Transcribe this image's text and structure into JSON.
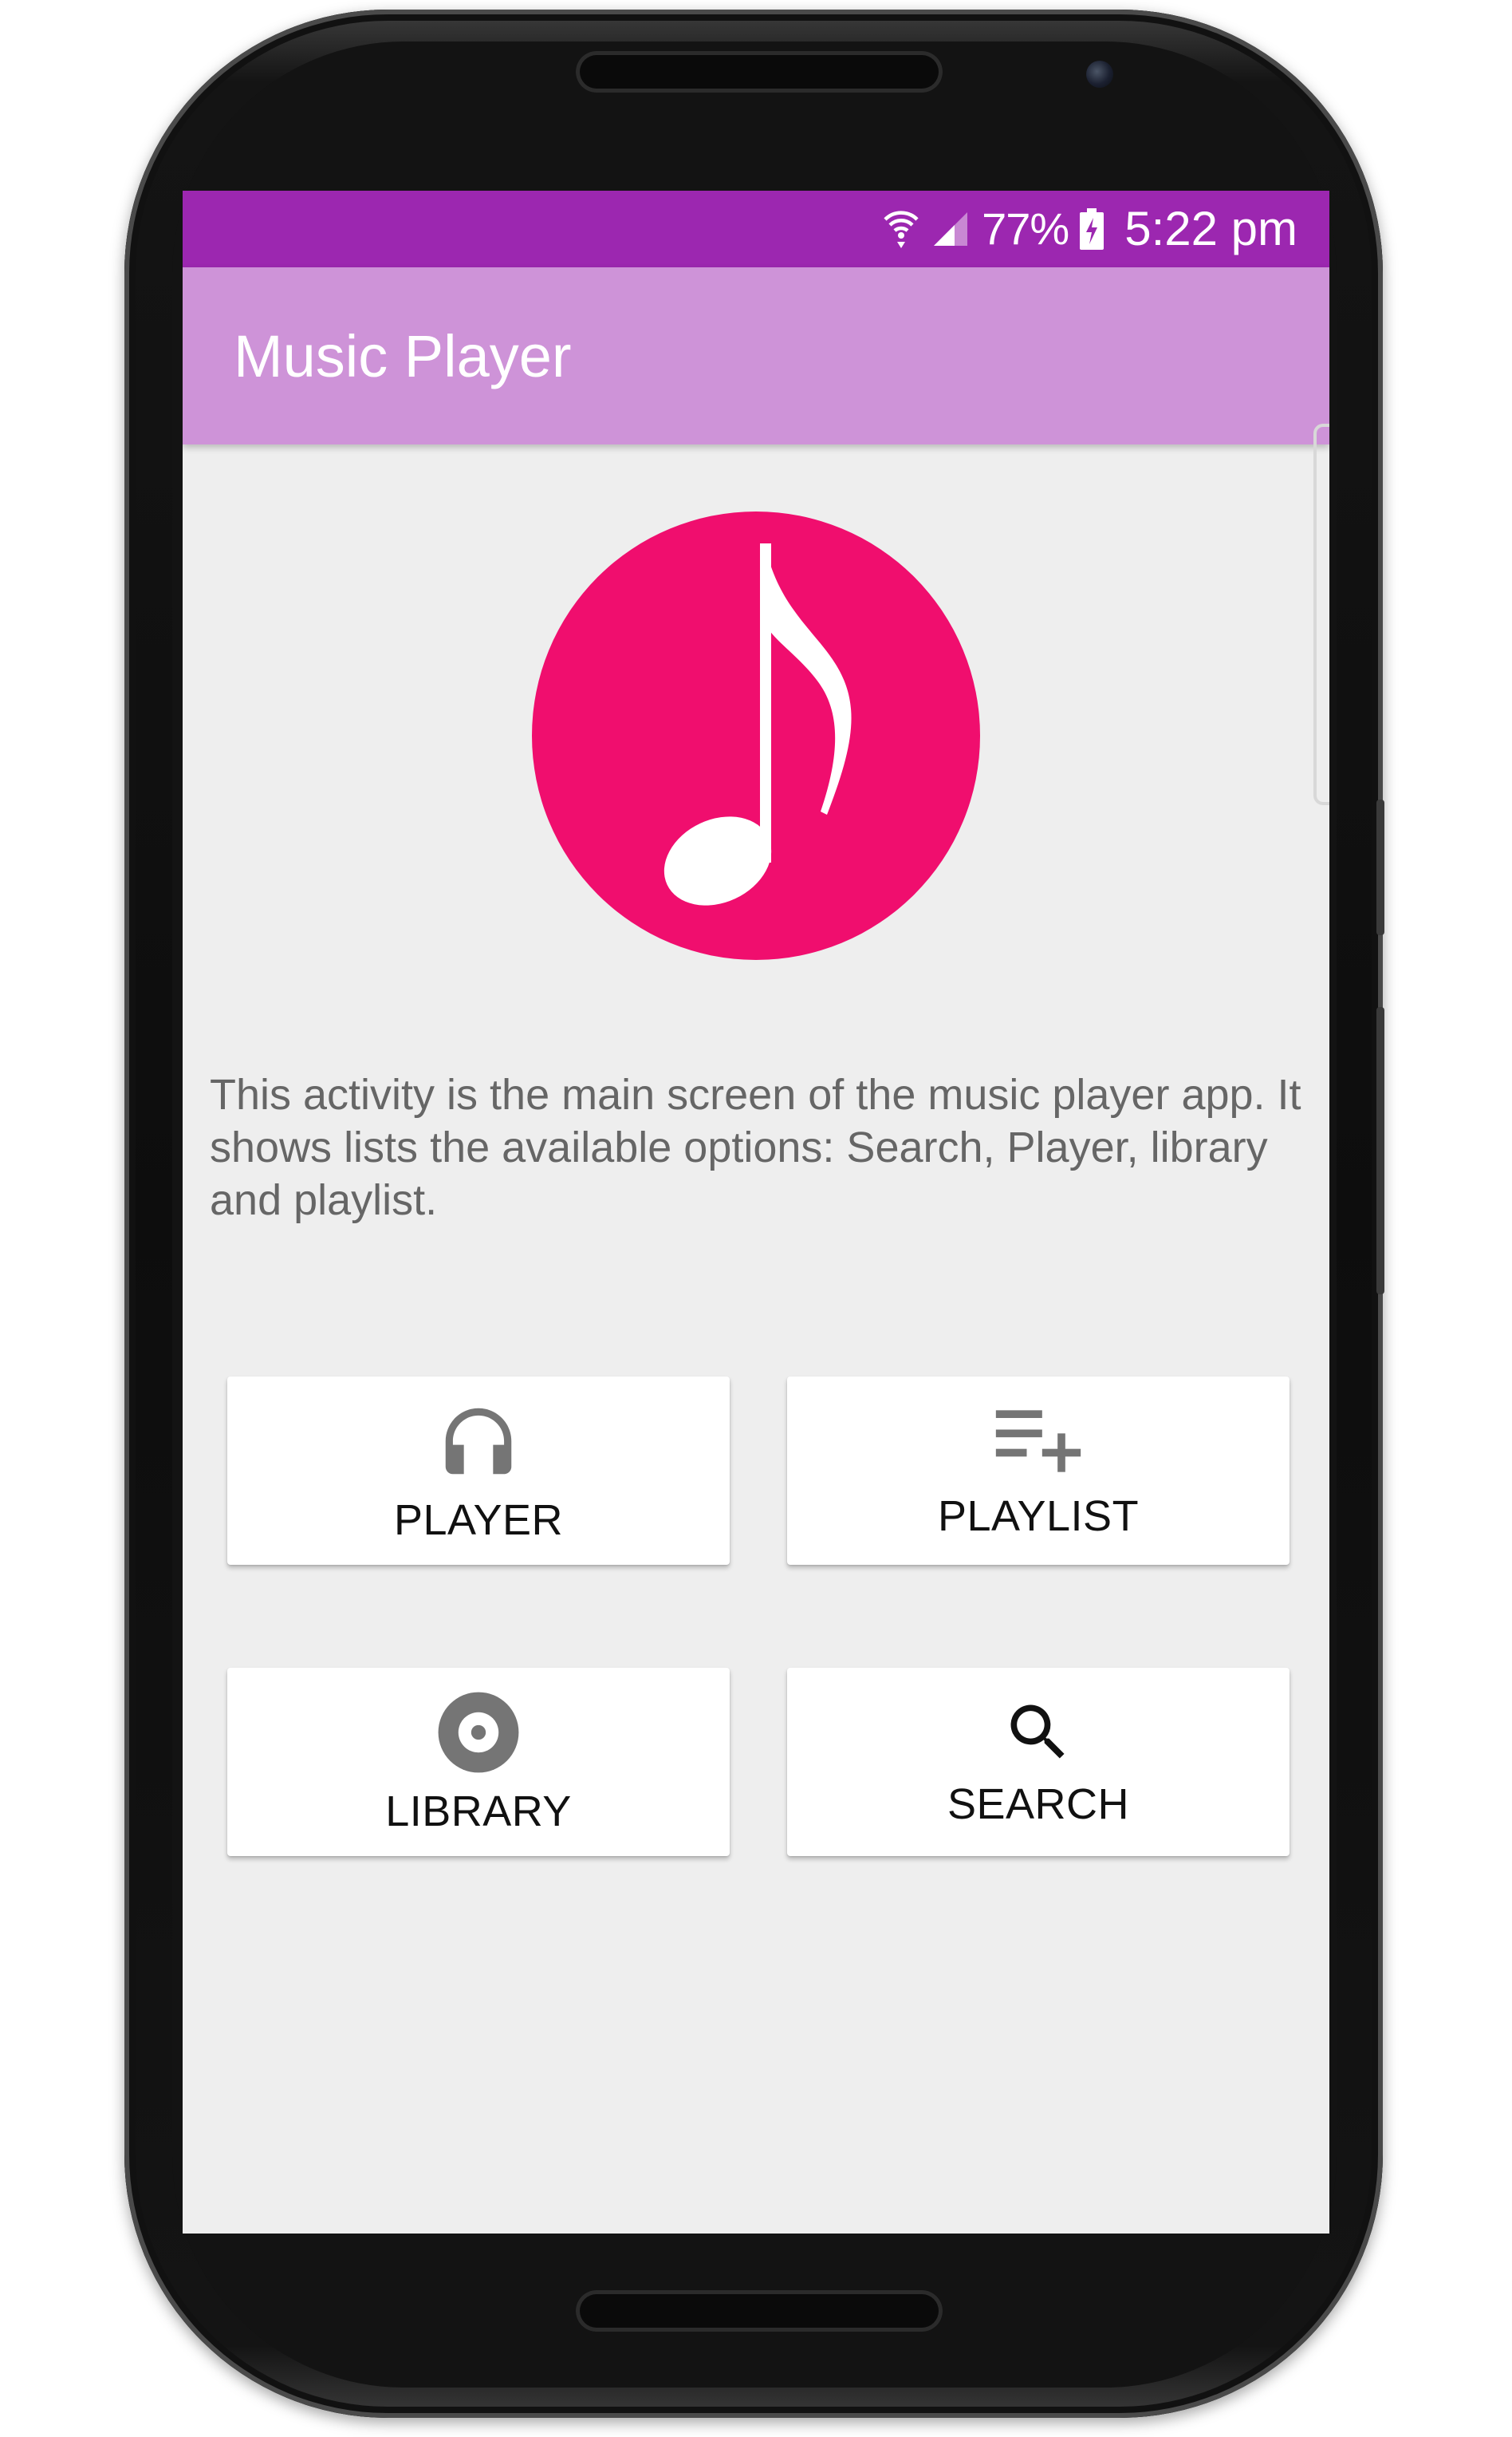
{
  "status_bar": {
    "battery_percent": "77%",
    "time": "5:22 pm",
    "icons": [
      "wifi-icon",
      "signal-icon",
      "battery-charging-icon"
    ],
    "color": "#9c27b0"
  },
  "app_bar": {
    "title": "Music Player",
    "color": "#ce93d8"
  },
  "logo": {
    "icon": "music-note-icon",
    "color": "#f00e6e"
  },
  "description": "This activity is the main screen of the music player app. It shows lists the available options: Search, Player, library and playlist.",
  "buttons": [
    {
      "label": "PLAYER",
      "icon": "headphones-icon"
    },
    {
      "label": "PLAYLIST",
      "icon": "playlist-add-icon"
    },
    {
      "label": "LIBRARY",
      "icon": "album-icon"
    },
    {
      "label": "SEARCH",
      "icon": "search-icon"
    }
  ],
  "colors": {
    "screen_background": "#eeeeee",
    "icon_gray": "#757575",
    "description_text": "#666666"
  }
}
